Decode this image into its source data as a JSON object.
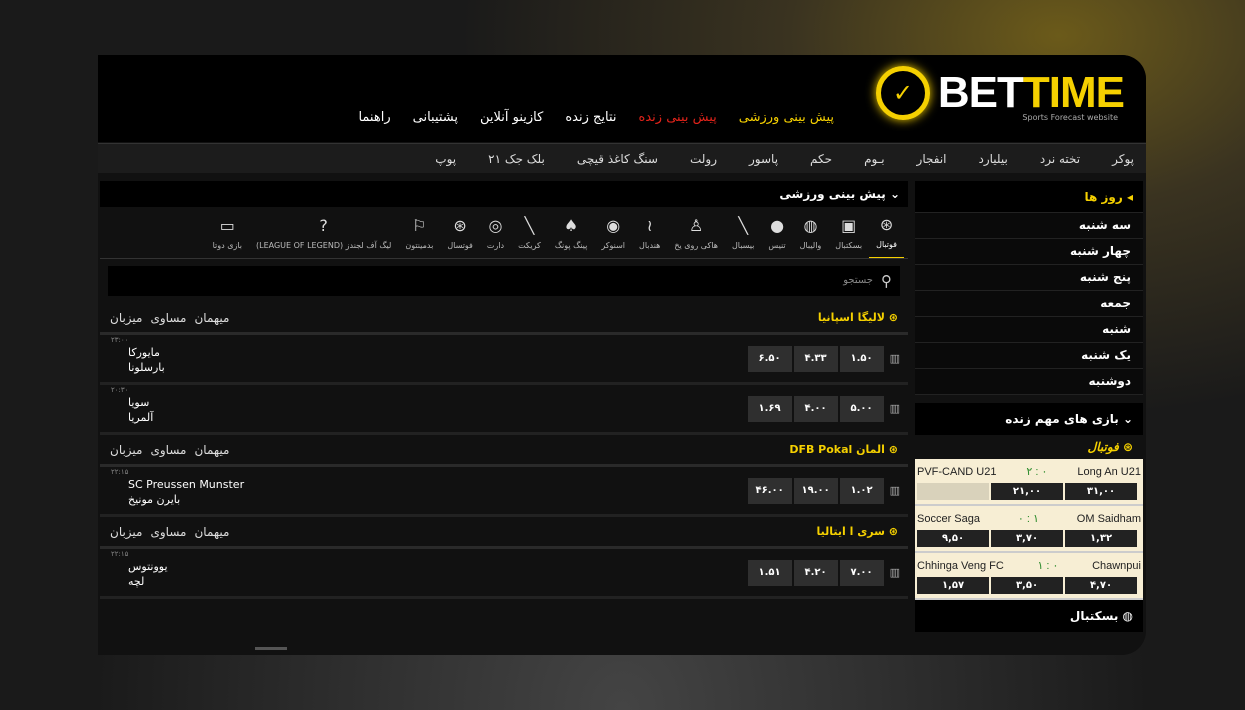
{
  "brand": {
    "name_a": "BET",
    "name_b": "TIME",
    "tagline": "Sports Forecast website"
  },
  "main_nav": [
    "پیش بینی ورزشی",
    "پیش بینی زنده",
    "نتایج زنده",
    "کازینو آنلاین",
    "پشتیبانی",
    "راهنما"
  ],
  "game_nav": [
    "پوکر",
    "تخته نرد",
    "بیلیارد",
    "انفجار",
    "بـوم",
    "حکم",
    "پاسور",
    "رولت",
    "سنگ کاغذ قیچی",
    "بلک جک ۲۱",
    "پوپ"
  ],
  "days": {
    "title": "روز ها",
    "items": [
      "سه شنبه",
      "چهار شنبه",
      "پنج شنبه",
      "جمعه",
      "شنبه",
      "یک شنبه",
      "دوشنبه"
    ]
  },
  "live": {
    "title": "بازی های مهم زنده",
    "sport": "فوتبال",
    "next_sport": "بسکتبال",
    "matches": [
      {
        "home": "PVF-CAND U21",
        "score": "۲ : ۰",
        "away": "Long An U21",
        "odds": [
          "",
          "۲۱,۰۰",
          "۳۱,۰۰"
        ]
      },
      {
        "home": "Soccer Saga",
        "score": "۰ : ۱",
        "away": "OM Saidham",
        "odds": [
          "۹,۵۰",
          "۳,۷۰",
          "۱,۳۲"
        ]
      },
      {
        "home": "Chhinga Veng FC",
        "score": "۱ : ۰",
        "away": "Chawnpui",
        "odds": [
          "۱,۵۷",
          "۳,۵۰",
          "۴,۷۰"
        ]
      }
    ]
  },
  "main": {
    "title": "پیش بینی ورزشی",
    "search_placeholder": "جستجو",
    "sports": [
      "فوتبال",
      "بسکتبال",
      "والیبال",
      "تنیس",
      "بیسبال",
      "هاکی روی یخ",
      "هندبال",
      "اسنوکر",
      "پینگ پونگ",
      "کریکت",
      "دارت",
      "فوتسال",
      "بدمینتون",
      "لیگ آف لجندز (LEAGUE OF LEGEND)",
      "بازی دوتا"
    ],
    "columns": [
      "میهمان",
      "مساوی",
      "میزبان"
    ],
    "leagues": [
      {
        "name": "لالیگا اسپانیا",
        "matches": [
          {
            "time": "۲۳:۰۰",
            "team1": "مایورکا",
            "team2": "بارسلونا",
            "odds": [
              "۱.۵۰",
              "۴.۳۳",
              "۶.۵۰"
            ]
          },
          {
            "time": "۲۰:۳۰",
            "team1": "سویا",
            "team2": "آلمریا",
            "odds": [
              "۵.۰۰",
              "۴.۰۰",
              "۱.۶۹"
            ]
          }
        ]
      },
      {
        "name": "المان DFB Pokal",
        "matches": [
          {
            "time": "۲۲:۱۵",
            "team1": "SC Preussen Munster",
            "team2": "بایرن مونیخ",
            "odds": [
              "۱.۰۲",
              "۱۹.۰۰",
              "۴۶.۰۰"
            ]
          }
        ]
      },
      {
        "name": "سری ا ایتالیا",
        "matches": [
          {
            "time": "۲۲:۱۵",
            "team1": "یوونتوس",
            "team2": "لچه",
            "odds": [
              "۷.۰۰",
              "۴.۲۰",
              "۱.۵۱"
            ]
          }
        ]
      }
    ]
  },
  "colors": {
    "accent": "#f5d000",
    "live": "#e2231a",
    "bg": "#111111"
  }
}
